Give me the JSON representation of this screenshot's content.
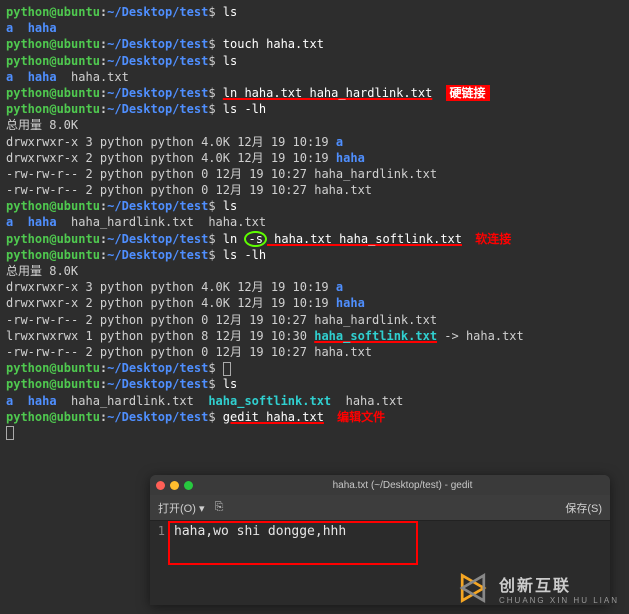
{
  "prompt": {
    "user": "python@ubuntu",
    "sep": ":",
    "path": "~/Desktop/test",
    "sym": "$"
  },
  "cmds": {
    "ls": "ls",
    "touch": "touch haha.txt",
    "ln_hard": "ln haha.txt haha_hardlink.txt",
    "ls_lh": "ls -lh",
    "ln_soft_pre": "ln ",
    "ln_soft_flag": "-s",
    "ln_soft_post": " haha.txt haha_softlink.txt",
    "gedit": "gedit haha.txt"
  },
  "out": {
    "a": "a",
    "haha": "haha",
    "haha_txt": "haha.txt",
    "hardlink": "haha_hardlink.txt",
    "softlink": "haha_softlink.txt",
    "arrow": " -> ",
    "total": "总用量 8.0K"
  },
  "ll1": {
    "r1": "drwxrwxr-x 3 python python 4.0K 12月 19 10:19 ",
    "r2": "drwxrwxr-x 2 python python 4.0K 12月 19 10:19 ",
    "r3": "-rw-rw-r-- 2 python python    0 12月 19 10:27 ",
    "r4": "-rw-rw-r-- 2 python python    0 12月 19 10:27 "
  },
  "ll2": {
    "r1": "drwxrwxr-x 3 python python 4.0K 12月 19 10:19 ",
    "r2": "drwxrwxr-x 2 python python 4.0K 12月 19 10:19 ",
    "r3": "-rw-rw-r-- 2 python python    0 12月 19 10:27 ",
    "r4": "lrwxrwxrwx 1 python python    8 12月 19 10:30 ",
    "r5": "-rw-rw-r-- 2 python python    0 12月 19 10:27 "
  },
  "labels": {
    "hardlink": "硬链接",
    "softlink": "软连接",
    "editfile": "编辑文件"
  },
  "gedit": {
    "title": "haha.txt (~/Desktop/test) - gedit",
    "open": "打开(O)",
    "open_caret": "▾",
    "newdoc_icon": "⎘",
    "save": "保存(S)",
    "line_no": "1",
    "content": "haha,wo shi  dongge,hhh"
  },
  "watermark": {
    "cn": "创新互联",
    "en": "CHUANG XIN HU LIAN"
  }
}
